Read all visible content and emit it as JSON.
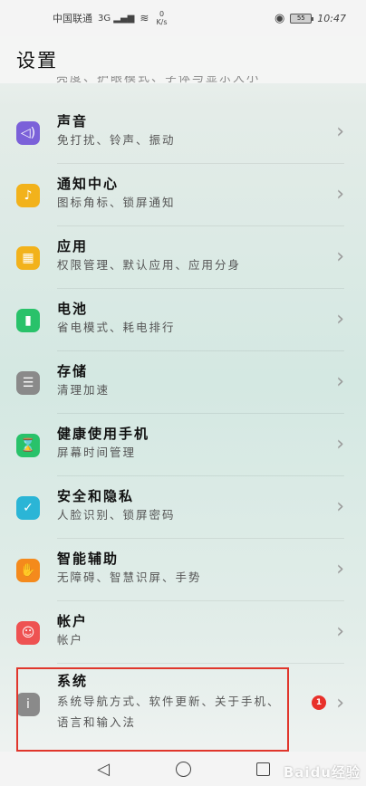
{
  "status_bar": {
    "carrier": "中国联通",
    "signal": "3G",
    "speed_value": "0",
    "speed_unit": "K/s",
    "battery_level": "55",
    "time": "10:47"
  },
  "header": {
    "title": "设置"
  },
  "partial_row": {
    "text": "亮度、护眼模式、字体与显示大小"
  },
  "items": [
    {
      "title": "声音",
      "subtitle": "免打扰、铃声、振动",
      "icon": "speaker-icon",
      "color": "#7b61d9",
      "glyph": "◁)"
    },
    {
      "title": "通知中心",
      "subtitle": "图标角标、锁屏通知",
      "icon": "bell-icon",
      "color": "#f2b21b",
      "glyph": "♪"
    },
    {
      "title": "应用",
      "subtitle": "权限管理、默认应用、应用分身",
      "icon": "apps-grid-icon",
      "color": "#f2b21b",
      "glyph": "▦"
    },
    {
      "title": "电池",
      "subtitle": "省电模式、耗电排行",
      "icon": "battery-icon",
      "color": "#29c26a",
      "glyph": "▮"
    },
    {
      "title": "存储",
      "subtitle": "清理加速",
      "icon": "storage-icon",
      "color": "#8a8a8a",
      "glyph": "☰"
    },
    {
      "title": "健康使用手机",
      "subtitle": "屏幕时间管理",
      "icon": "hourglass-icon",
      "color": "#29c26a",
      "glyph": "⌛"
    },
    {
      "title": "安全和隐私",
      "subtitle": "人脸识别、锁屏密码",
      "icon": "shield-icon",
      "color": "#2bb5d6",
      "glyph": "✓"
    },
    {
      "title": "智能辅助",
      "subtitle": "无障碍、智慧识屏、手势",
      "icon": "hand-icon",
      "color": "#f48a1c",
      "glyph": "✋"
    },
    {
      "title": "帐户",
      "subtitle": "帐户",
      "icon": "account-icon",
      "color": "#ee5252",
      "glyph": "☺"
    }
  ],
  "system_item": {
    "title": "系统",
    "subtitle": "系统导航方式、软件更新、关于手机、语言和输入法",
    "icon": "system-icon",
    "color": "#8a8a8a",
    "glyph": "ⅰ",
    "badge": "1"
  },
  "watermark": "Baidu经验"
}
